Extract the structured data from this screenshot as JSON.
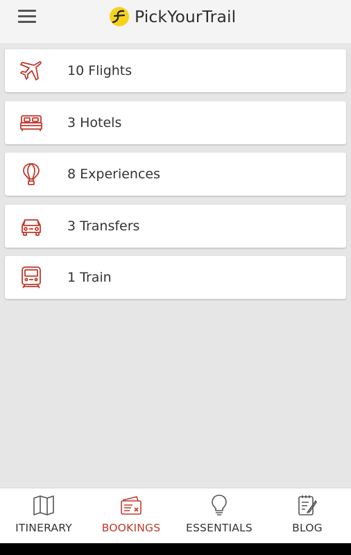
{
  "app": {
    "title": "PickYourTrail"
  },
  "colors": {
    "accent": "#c0392b",
    "logo_yellow": "#f6d21e",
    "background": "#e6e6e6"
  },
  "bookings": [
    {
      "label": "10 Flights",
      "icon": "airplane-icon"
    },
    {
      "label": "3 Hotels",
      "icon": "bed-icon"
    },
    {
      "label": "8 Experiences",
      "icon": "hot-air-balloon-icon"
    },
    {
      "label": "3 Transfers",
      "icon": "car-icon"
    },
    {
      "label": "1 Train",
      "icon": "train-icon"
    }
  ],
  "tabs": [
    {
      "label": "ITINERARY",
      "icon": "map-icon",
      "active": false
    },
    {
      "label": "BOOKINGS",
      "icon": "ticket-icon",
      "active": true
    },
    {
      "label": "ESSENTIALS",
      "icon": "lightbulb-icon",
      "active": false
    },
    {
      "label": "BLOG",
      "icon": "notepad-pen-icon",
      "active": false
    }
  ]
}
